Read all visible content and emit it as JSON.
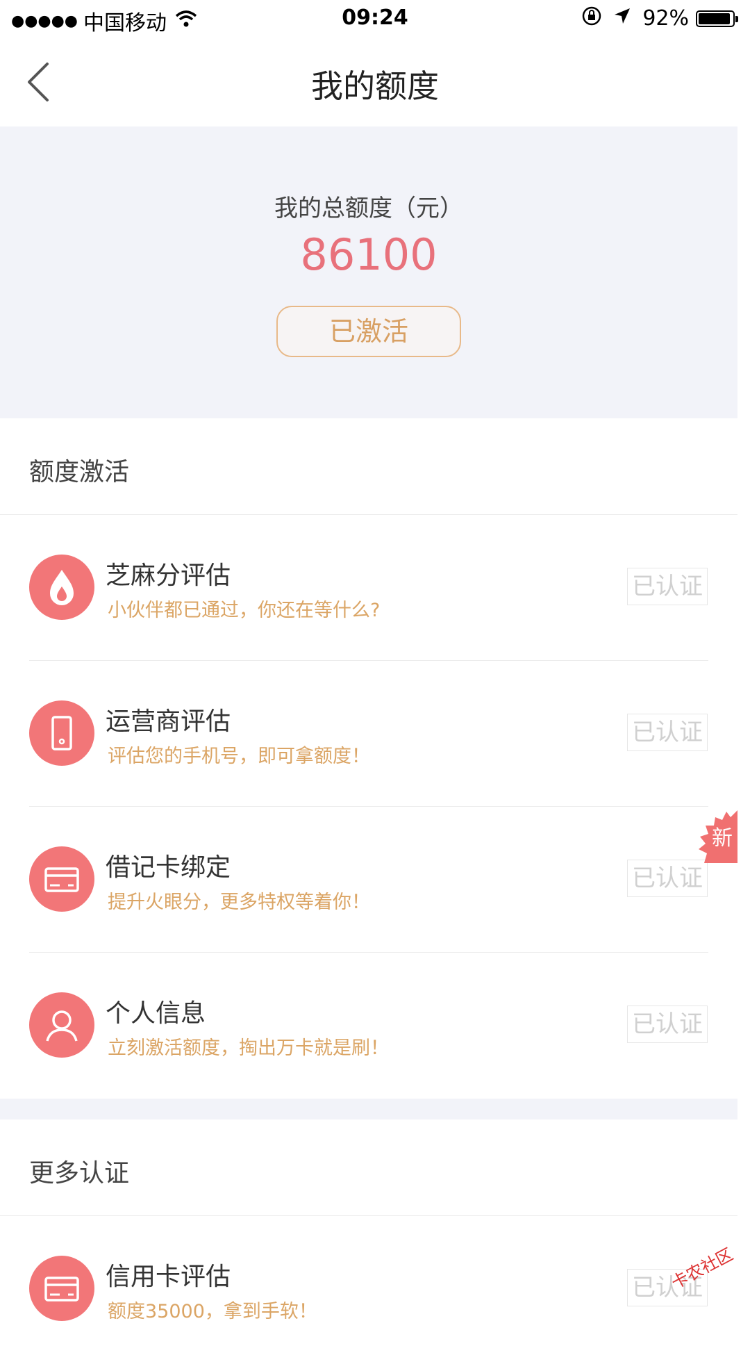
{
  "status_bar": {
    "signal": "●●●●●",
    "carrier": "中国移动",
    "time": "09:24",
    "battery_percent": "92%",
    "battery_level": 0.92
  },
  "nav": {
    "back_icon": "chevron-left-icon",
    "title": "我的额度"
  },
  "hero": {
    "label": "我的总额度（元）",
    "amount": "86100",
    "status_button": "已激活",
    "accent_color": "#e8717b",
    "button_color": "#d8a063"
  },
  "sections": [
    {
      "header": "额度激活",
      "items": [
        {
          "icon": "flame-icon",
          "title": "芝麻分评估",
          "subtitle": "小伙伴都已通过，你还在等什么?",
          "status": "已认证"
        },
        {
          "icon": "phone-icon",
          "title": "运营商评估",
          "subtitle": "评估您的手机号，即可拿额度！",
          "status": "已认证"
        },
        {
          "icon": "card-icon",
          "title": "借记卡绑定",
          "subtitle": "提升火眼分，更多特权等着你！",
          "status": "已认证",
          "badge": "新"
        },
        {
          "icon": "person-icon",
          "title": "个人信息",
          "subtitle": "立刻激活额度，掏出万卡就是刷！",
          "status": "已认证"
        }
      ]
    },
    {
      "header": "更多认证",
      "items": [
        {
          "icon": "card-icon",
          "title": "信用卡评估",
          "subtitle": "额度35000，拿到手软！",
          "status": "已认证"
        }
      ]
    }
  ],
  "watermark": "卡农社区"
}
